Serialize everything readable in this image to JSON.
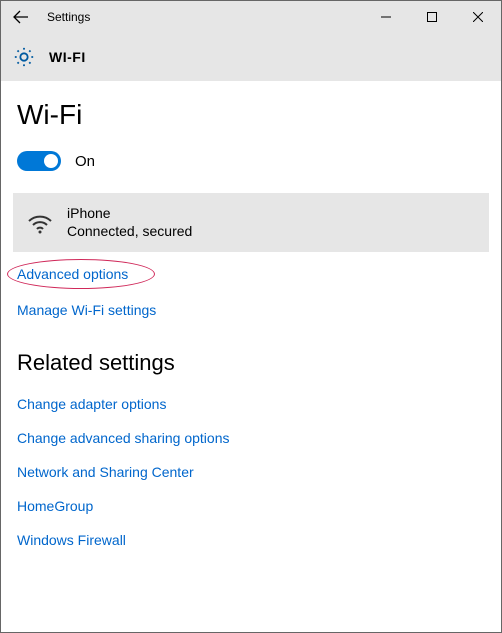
{
  "titlebar": {
    "app_title": "Settings"
  },
  "section": {
    "title": "WI-FI"
  },
  "page": {
    "heading": "Wi-Fi",
    "toggle": {
      "state": "On"
    },
    "network": {
      "name": "iPhone",
      "status": "Connected, secured"
    },
    "links": {
      "advanced": "Advanced options",
      "manage": "Manage Wi-Fi settings"
    },
    "related": {
      "heading": "Related settings",
      "items": [
        "Change adapter options",
        "Change advanced sharing options",
        "Network and Sharing Center",
        "HomeGroup",
        "Windows Firewall"
      ]
    }
  }
}
